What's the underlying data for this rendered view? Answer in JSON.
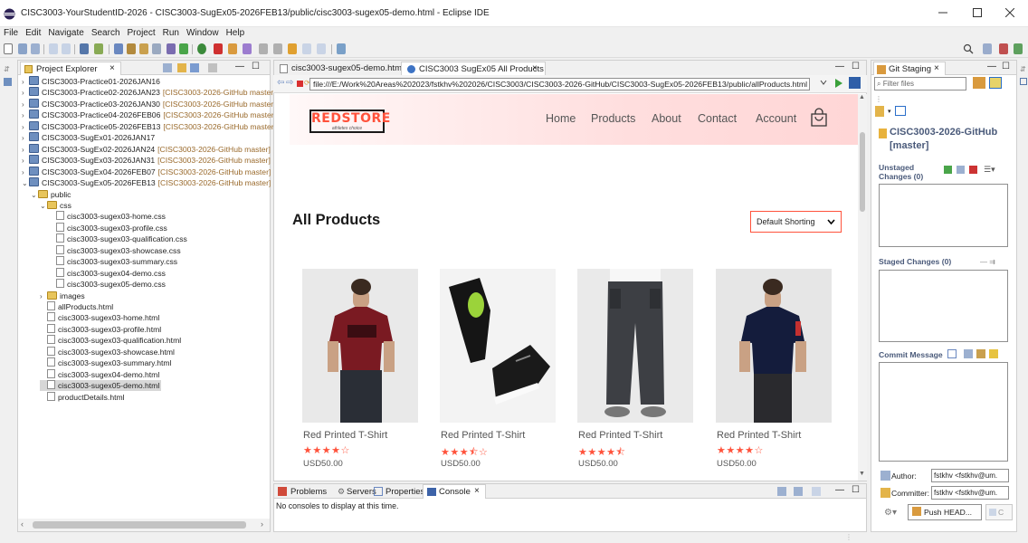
{
  "window": {
    "title": "CISC3003-YourStudentID-2026 - CISC3003-SugEx05-2026FEB13/public/cisc3003-sugex05-demo.html - Eclipse IDE",
    "minimize": "—",
    "maximize": "☐",
    "close": "✕"
  },
  "menu": [
    "File",
    "Edit",
    "Navigate",
    "Search",
    "Project",
    "Run",
    "Window",
    "Help"
  ],
  "project_explorer": {
    "tab_label": "Project Explorer",
    "tree": [
      {
        "indent": 0,
        "arrow": ">",
        "icon": "project",
        "label": "CISC3003-Practice01-2026JAN16",
        "git": ""
      },
      {
        "indent": 0,
        "arrow": ">",
        "icon": "project",
        "label": "CISC3003-Practice02-2026JAN23",
        "git": "[CISC3003-2026-GitHub master]"
      },
      {
        "indent": 0,
        "arrow": ">",
        "icon": "project",
        "label": "CISC3003-Practice03-2026JAN30",
        "git": "[CISC3003-2026-GitHub master]"
      },
      {
        "indent": 0,
        "arrow": ">",
        "icon": "project",
        "label": "CISC3003-Practice04-2026FEB06",
        "git": "[CISC3003-2026-GitHub master]"
      },
      {
        "indent": 0,
        "arrow": ">",
        "icon": "project",
        "label": "CISC3003-Practice05-2026FEB13",
        "git": "[CISC3003-2026-GitHub master]"
      },
      {
        "indent": 0,
        "arrow": ">",
        "icon": "project",
        "label": "CISC3003-SugEx01-2026JAN17",
        "git": ""
      },
      {
        "indent": 0,
        "arrow": ">",
        "icon": "project",
        "label": "CISC3003-SugEx02-2026JAN24",
        "git": "[CISC3003-2026-GitHub master]"
      },
      {
        "indent": 0,
        "arrow": ">",
        "icon": "project",
        "label": "CISC3003-SugEx03-2026JAN31",
        "git": "[CISC3003-2026-GitHub master]"
      },
      {
        "indent": 0,
        "arrow": ">",
        "icon": "project",
        "label": "CISC3003-SugEx04-2026FEB07",
        "git": "[CISC3003-2026-GitHub master]"
      },
      {
        "indent": 0,
        "arrow": "v",
        "icon": "project",
        "label": "CISC3003-SugEx05-2026FEB13",
        "git": "[CISC3003-2026-GitHub master]"
      },
      {
        "indent": 1,
        "arrow": "v",
        "icon": "folder",
        "label": "public",
        "git": ""
      },
      {
        "indent": 2,
        "arrow": "v",
        "icon": "folder",
        "label": "css",
        "git": ""
      },
      {
        "indent": 3,
        "arrow": "",
        "icon": "file",
        "label": "cisc3003-sugex03-home.css",
        "git": ""
      },
      {
        "indent": 3,
        "arrow": "",
        "icon": "file",
        "label": "cisc3003-sugex03-profile.css",
        "git": ""
      },
      {
        "indent": 3,
        "arrow": "",
        "icon": "file",
        "label": "cisc3003-sugex03-qualification.css",
        "git": ""
      },
      {
        "indent": 3,
        "arrow": "",
        "icon": "file",
        "label": "cisc3003-sugex03-showcase.css",
        "git": ""
      },
      {
        "indent": 3,
        "arrow": "",
        "icon": "file",
        "label": "cisc3003-sugex03-summary.css",
        "git": ""
      },
      {
        "indent": 3,
        "arrow": "",
        "icon": "file",
        "label": "cisc3003-sugex04-demo.css",
        "git": ""
      },
      {
        "indent": 3,
        "arrow": "",
        "icon": "file",
        "label": "cisc3003-sugex05-demo.css",
        "git": ""
      },
      {
        "indent": 2,
        "arrow": ">",
        "icon": "folder",
        "label": "images",
        "git": ""
      },
      {
        "indent": 2,
        "arrow": "",
        "icon": "file",
        "label": "allProducts.html",
        "git": ""
      },
      {
        "indent": 2,
        "arrow": "",
        "icon": "file",
        "label": "cisc3003-sugex03-home.html",
        "git": ""
      },
      {
        "indent": 2,
        "arrow": "",
        "icon": "file",
        "label": "cisc3003-sugex03-profile.html",
        "git": ""
      },
      {
        "indent": 2,
        "arrow": "",
        "icon": "file",
        "label": "cisc3003-sugex03-qualification.html",
        "git": ""
      },
      {
        "indent": 2,
        "arrow": "",
        "icon": "file",
        "label": "cisc3003-sugex03-showcase.html",
        "git": ""
      },
      {
        "indent": 2,
        "arrow": "",
        "icon": "file",
        "label": "cisc3003-sugex03-summary.html",
        "git": ""
      },
      {
        "indent": 2,
        "arrow": "",
        "icon": "file",
        "label": "cisc3003-sugex04-demo.html",
        "git": ""
      },
      {
        "indent": 2,
        "arrow": "",
        "icon": "file",
        "label": "cisc3003-sugex05-demo.html",
        "git": "",
        "selected": true
      },
      {
        "indent": 2,
        "arrow": "",
        "icon": "file",
        "label": "productDetails.html",
        "git": ""
      }
    ]
  },
  "editor": {
    "tabs": [
      {
        "label": "cisc3003-sugex05-demo.html",
        "active": false
      },
      {
        "label": "CISC3003 SugEx05 All Products",
        "active": true
      }
    ],
    "url": "file:///E:/Work%20Areas%202023/fstkhv%202026/CISC3003/CISC3003-2026-GitHub/CISC3003-SugEx05-2026FEB13/public/allProducts.html"
  },
  "website": {
    "logo": "REDSTORE",
    "logo_tagline": "athletes choice",
    "nav": [
      "Home",
      "Products",
      "About",
      "Contact",
      "Account"
    ],
    "heading": "All Products",
    "sort_selected": "Default Shorting",
    "products": [
      {
        "name": "Red Printed T-Shirt",
        "stars": "★★★★☆",
        "price": "USD50.00",
        "kind": "tshirt-red"
      },
      {
        "name": "Red Printed T-Shirt",
        "stars": "★★★⯪☆",
        "price": "USD50.00",
        "kind": "shoes"
      },
      {
        "name": "Red Printed T-Shirt",
        "stars": "★★★★⯪",
        "price": "USD50.00",
        "kind": "pants"
      },
      {
        "name": "Red Printed T-Shirt",
        "stars": "★★★★☆",
        "price": "USD50.00",
        "kind": "polo-navy"
      }
    ],
    "accent": "#ff523b"
  },
  "console": {
    "tabs": [
      "Problems",
      "Servers",
      "Properties",
      "Console"
    ],
    "message": "No consoles to display at this time."
  },
  "git_staging": {
    "tab_label": "Git Staging",
    "filter_placeholder": "Filter files",
    "repo": "CISC3003-2026-GitHub",
    "branch": "[master]",
    "unstaged_label": "Unstaged",
    "unstaged_count": "Changes (0)",
    "staged_label": "Staged Changes (0)",
    "commit_label": "Commit Message",
    "author_label": "Author:",
    "author_value": "fstkhv <fstkhv@um.",
    "committer_label": "Committer:",
    "committer_value": "fstkhv <fstkhv@um.",
    "push_label": "Push HEAD...",
    "commit_btn": "C"
  }
}
